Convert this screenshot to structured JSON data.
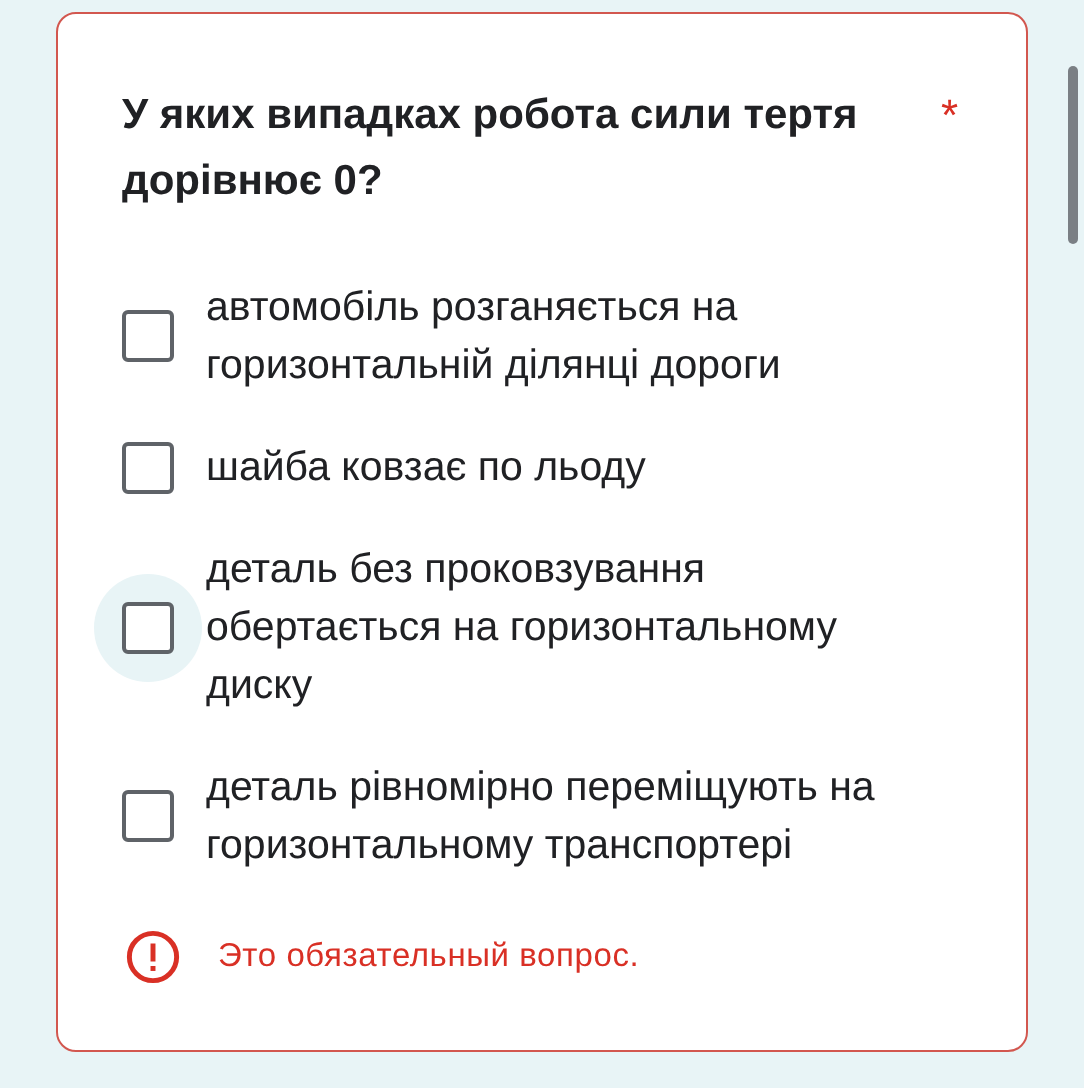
{
  "question": {
    "title": "У яких випадках робота сили тертя дорівнює 0?",
    "required_mark": "*"
  },
  "options": [
    {
      "label": "автомобіль розганяється на горизонтальній ділянці дороги",
      "checked": false,
      "focused": false
    },
    {
      "label": "шайба ковзає по льоду",
      "checked": false,
      "focused": false
    },
    {
      "label": "деталь без проковзування обертається на горизонтальному диску",
      "checked": false,
      "focused": true
    },
    {
      "label": "деталь рівномірно переміщують на горизонтальному транспортері",
      "checked": false,
      "focused": false
    }
  ],
  "error": {
    "message": "Это обязательный вопрос."
  }
}
